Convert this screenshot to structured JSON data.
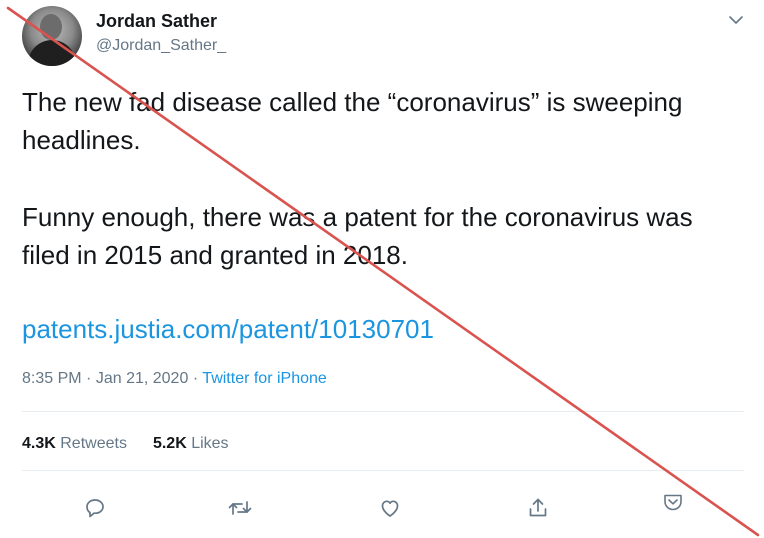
{
  "author": {
    "display_name": "Jordan Sather",
    "handle": "@Jordan_Sather_"
  },
  "tweet": {
    "paragraph_1": "The new fad disease called the “coronavirus” is sweeping headlines.",
    "paragraph_2": "Funny enough, there was a patent for the coronavirus was filed in 2015 and granted in 2018.",
    "link": "patents.justia.com/patent/10130701"
  },
  "meta": {
    "time": "8:35 PM",
    "separator": "·",
    "date": "Jan 21, 2020",
    "source": "Twitter for iPhone"
  },
  "stats": {
    "retweets_count": "4.3K",
    "retweets_label": "Retweets",
    "likes_count": "5.2K",
    "likes_label": "Likes"
  },
  "actions": [
    "reply-icon",
    "retweet-icon",
    "like-icon",
    "share-icon",
    "pocket-icon"
  ],
  "colors": {
    "link": "#1b95e0",
    "secondary_text": "#657786",
    "primary_text": "#14171a",
    "strike_line": "#d9534f"
  }
}
